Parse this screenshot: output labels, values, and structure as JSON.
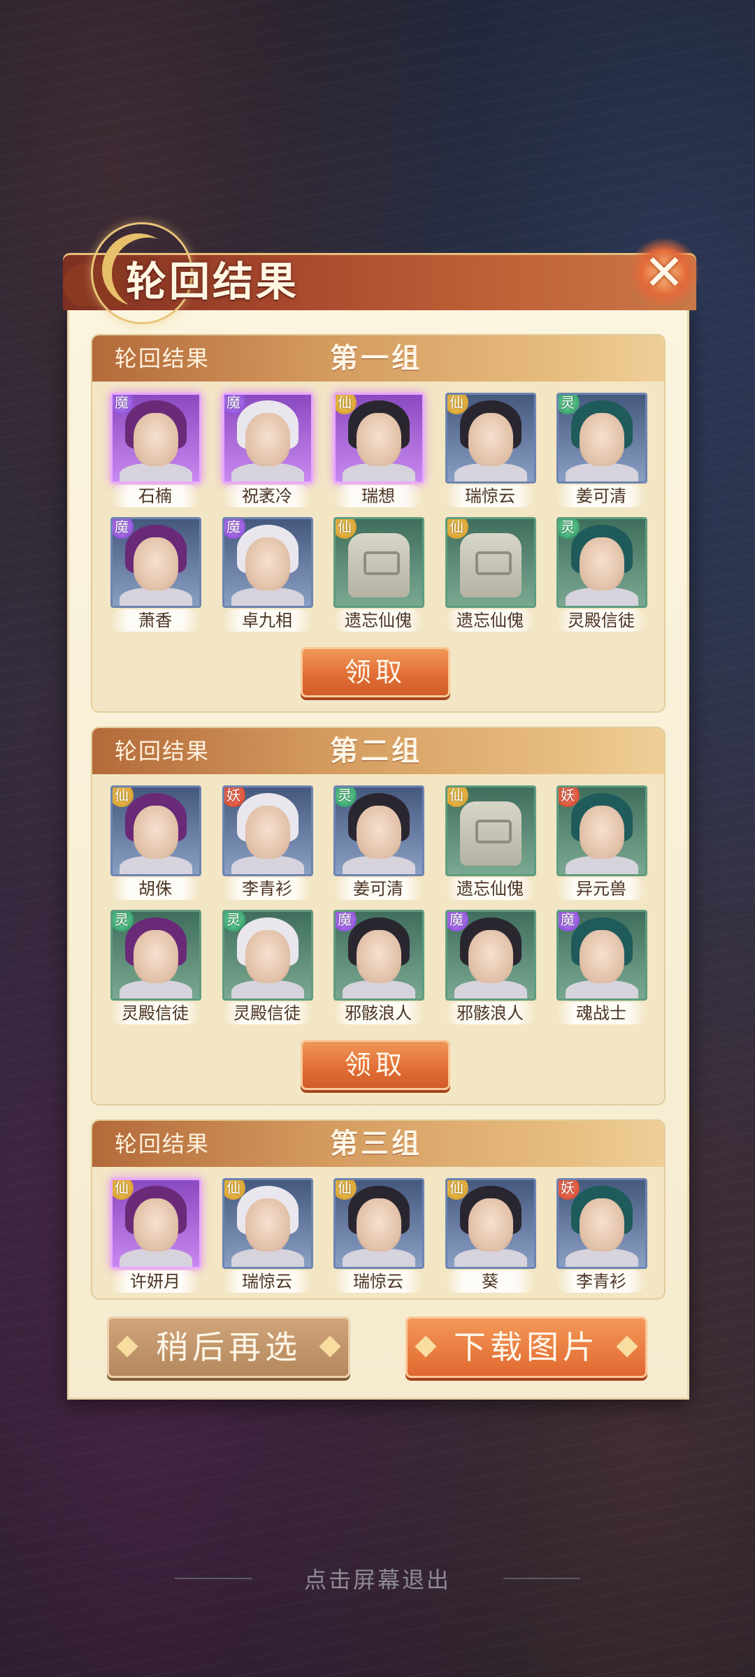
{
  "header": {
    "title": "轮回结果"
  },
  "groups": [
    {
      "label": "轮回结果",
      "title": "第一组",
      "claim_label": "领取",
      "characters": [
        {
          "name": "石楠",
          "faction": "魔",
          "frame": "purple"
        },
        {
          "name": "祝袤冷",
          "faction": "魔",
          "frame": "purple"
        },
        {
          "name": "瑞想",
          "faction": "仙",
          "frame": "purple"
        },
        {
          "name": "瑞惊云",
          "faction": "仙",
          "frame": "blue"
        },
        {
          "name": "姜可清",
          "faction": "灵",
          "frame": "blue"
        },
        {
          "name": "萧香",
          "faction": "魔",
          "frame": "blue"
        },
        {
          "name": "卓九相",
          "faction": "魔",
          "frame": "blue"
        },
        {
          "name": "遗忘仙傀",
          "faction": "仙",
          "frame": "green"
        },
        {
          "name": "遗忘仙傀",
          "faction": "仙",
          "frame": "green"
        },
        {
          "name": "灵殿信徒",
          "faction": "灵",
          "frame": "green"
        }
      ]
    },
    {
      "label": "轮回结果",
      "title": "第二组",
      "claim_label": "领取",
      "characters": [
        {
          "name": "胡侏",
          "faction": "仙",
          "frame": "blue"
        },
        {
          "name": "李青衫",
          "faction": "妖",
          "frame": "blue"
        },
        {
          "name": "姜可清",
          "faction": "灵",
          "frame": "blue"
        },
        {
          "name": "遗忘仙傀",
          "faction": "仙",
          "frame": "green"
        },
        {
          "name": "异元兽",
          "faction": "妖",
          "frame": "green"
        },
        {
          "name": "灵殿信徒",
          "faction": "灵",
          "frame": "green"
        },
        {
          "name": "灵殿信徒",
          "faction": "灵",
          "frame": "green"
        },
        {
          "name": "邪骸浪人",
          "faction": "魔",
          "frame": "green"
        },
        {
          "name": "邪骸浪人",
          "faction": "魔",
          "frame": "green"
        },
        {
          "name": "魂战士",
          "faction": "魔",
          "frame": "green"
        }
      ]
    },
    {
      "label": "轮回结果",
      "title": "第三组",
      "characters": [
        {
          "name": "许妍月",
          "faction": "仙",
          "frame": "purple"
        },
        {
          "name": "瑞惊云",
          "faction": "仙",
          "frame": "blue"
        },
        {
          "name": "瑞惊云",
          "faction": "仙",
          "frame": "blue"
        },
        {
          "name": "葵",
          "faction": "仙",
          "frame": "blue"
        },
        {
          "name": "李青衫",
          "faction": "妖",
          "frame": "blue"
        }
      ]
    }
  ],
  "buttons": {
    "later": "稍后再选",
    "download": "下载图片"
  },
  "footer": {
    "exit_hint": "点击屏幕退出"
  },
  "icons": {
    "close": "close-icon",
    "moon": "crescent-moon-icon"
  },
  "colors": {
    "accent": "#e06c34",
    "panel": "#f5ebcf",
    "banner": "#a8482d"
  }
}
